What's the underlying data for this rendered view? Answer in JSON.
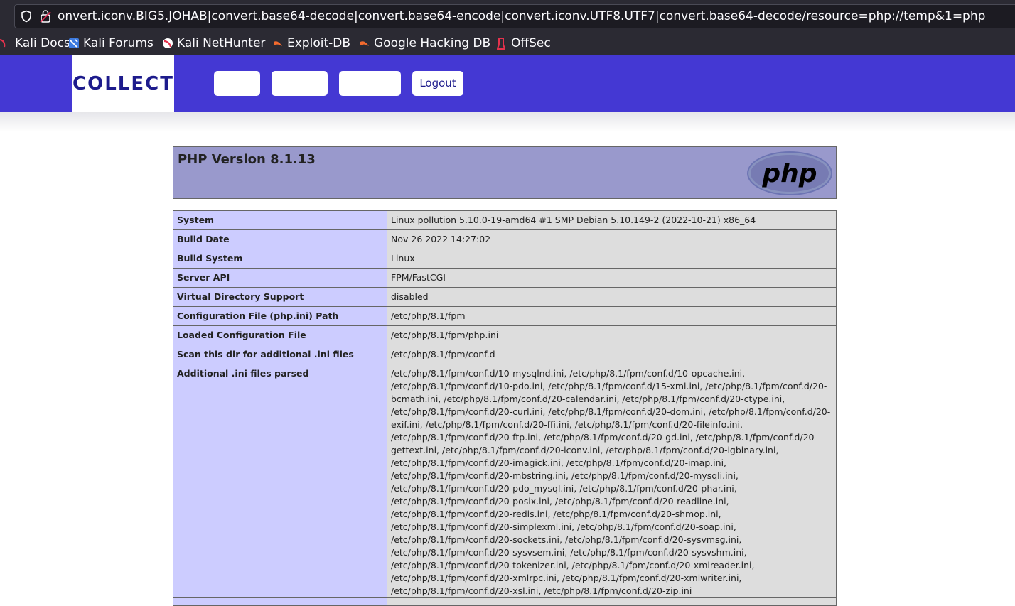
{
  "browser": {
    "url": "onvert.iconv.BIG5.JOHAB|convert.base64-decode|convert.base64-encode|convert.iconv.UTF8.UTF7|convert.base64-decode/resource=php://temp&1=php",
    "bookmarks": [
      {
        "label": "Kali Docs",
        "icon": "kali-docs-icon"
      },
      {
        "label": "Kali Forums",
        "icon": "kali-forums-icon"
      },
      {
        "label": "Kali NetHunter",
        "icon": "kali-nethunter-icon"
      },
      {
        "label": "Exploit-DB",
        "icon": "exploit-db-icon"
      },
      {
        "label": "Google Hacking DB",
        "icon": "google-hacking-db-icon"
      },
      {
        "label": "OffSec",
        "icon": "offsec-icon"
      }
    ]
  },
  "site": {
    "brand": "COLLECT",
    "nav": [
      "",
      "",
      "",
      "Logout"
    ],
    "colors": {
      "header": "#4438d3",
      "brand_text": "#1d1b8c"
    }
  },
  "phpinfo": {
    "version_title": "PHP Version 8.1.13",
    "logo_text": "php",
    "rows": [
      {
        "key": "System",
        "value": "Linux pollution 5.10.0-19-amd64 #1 SMP Debian 5.10.149-2 (2022-10-21) x86_64"
      },
      {
        "key": "Build Date",
        "value": "Nov 26 2022 14:27:02"
      },
      {
        "key": "Build System",
        "value": "Linux"
      },
      {
        "key": "Server API",
        "value": "FPM/FastCGI"
      },
      {
        "key": "Virtual Directory Support",
        "value": "disabled"
      },
      {
        "key": "Configuration File (php.ini) Path",
        "value": "/etc/php/8.1/fpm"
      },
      {
        "key": "Loaded Configuration File",
        "value": "/etc/php/8.1/fpm/php.ini"
      },
      {
        "key": "Scan this dir for additional .ini files",
        "value": "/etc/php/8.1/fpm/conf.d"
      },
      {
        "key": "Additional .ini files parsed",
        "value": "/etc/php/8.1/fpm/conf.d/10-mysqlnd.ini, /etc/php/8.1/fpm/conf.d/10-opcache.ini, /etc/php/8.1/fpm/conf.d/10-pdo.ini, /etc/php/8.1/fpm/conf.d/15-xml.ini, /etc/php/8.1/fpm/conf.d/20-bcmath.ini, /etc/php/8.1/fpm/conf.d/20-calendar.ini, /etc/php/8.1/fpm/conf.d/20-ctype.ini, /etc/php/8.1/fpm/conf.d/20-curl.ini, /etc/php/8.1/fpm/conf.d/20-dom.ini, /etc/php/8.1/fpm/conf.d/20-exif.ini, /etc/php/8.1/fpm/conf.d/20-ffi.ini, /etc/php/8.1/fpm/conf.d/20-fileinfo.ini, /etc/php/8.1/fpm/conf.d/20-ftp.ini, /etc/php/8.1/fpm/conf.d/20-gd.ini, /etc/php/8.1/fpm/conf.d/20-gettext.ini, /etc/php/8.1/fpm/conf.d/20-iconv.ini, /etc/php/8.1/fpm/conf.d/20-igbinary.ini, /etc/php/8.1/fpm/conf.d/20-imagick.ini, /etc/php/8.1/fpm/conf.d/20-imap.ini, /etc/php/8.1/fpm/conf.d/20-mbstring.ini, /etc/php/8.1/fpm/conf.d/20-mysqli.ini, /etc/php/8.1/fpm/conf.d/20-pdo_mysql.ini, /etc/php/8.1/fpm/conf.d/20-phar.ini, /etc/php/8.1/fpm/conf.d/20-posix.ini, /etc/php/8.1/fpm/conf.d/20-readline.ini, /etc/php/8.1/fpm/conf.d/20-redis.ini, /etc/php/8.1/fpm/conf.d/20-shmop.ini, /etc/php/8.1/fpm/conf.d/20-simplexml.ini, /etc/php/8.1/fpm/conf.d/20-soap.ini, /etc/php/8.1/fpm/conf.d/20-sockets.ini, /etc/php/8.1/fpm/conf.d/20-sysvmsg.ini, /etc/php/8.1/fpm/conf.d/20-sysvsem.ini, /etc/php/8.1/fpm/conf.d/20-sysvshm.ini, /etc/php/8.1/fpm/conf.d/20-tokenizer.ini, /etc/php/8.1/fpm/conf.d/20-xmlreader.ini, /etc/php/8.1/fpm/conf.d/20-xmlrpc.ini, /etc/php/8.1/fpm/conf.d/20-xmlwriter.ini, /etc/php/8.1/fpm/conf.d/20-xsl.ini, /etc/php/8.1/fpm/conf.d/20-zip.ini"
      }
    ]
  }
}
